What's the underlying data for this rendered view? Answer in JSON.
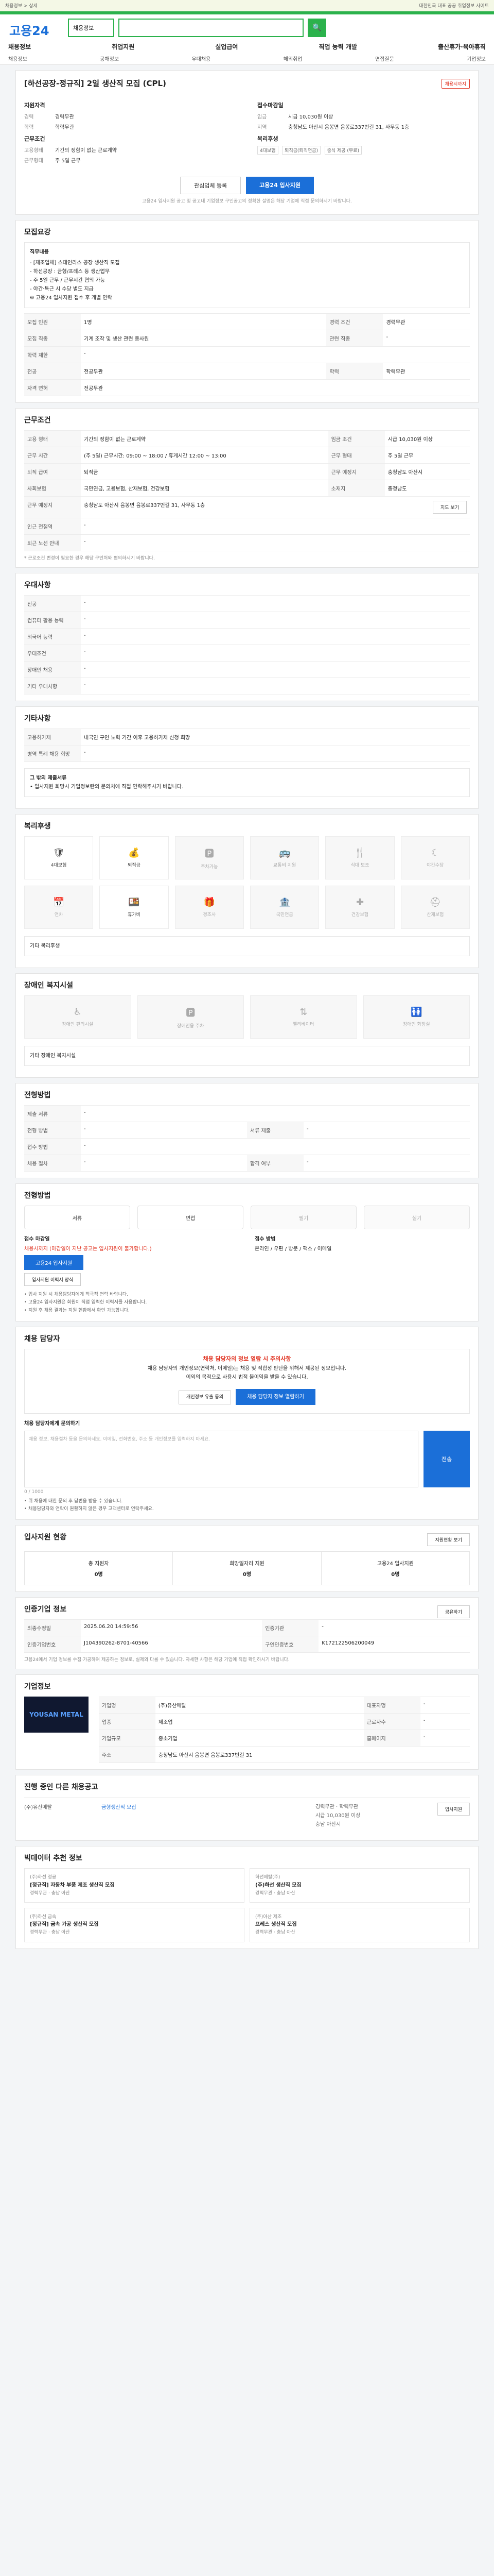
{
  "top": {
    "left": "채용정보 > 상세",
    "right": "대한민국 대표 공공 취업정보 사이트"
  },
  "header": {
    "logo": "고용24",
    "search_select": "채용정보",
    "search_button": "🔍",
    "gnb": [
      "채용정보",
      "취업지원",
      "실업급여",
      "직업 능력 개발",
      "출산휴가·육아휴직"
    ],
    "subnav": [
      "채용정보",
      "공채정보",
      "우대채용",
      "해외취업",
      "면접질문",
      "기업정보"
    ]
  },
  "job": {
    "title": "[하선공장-정규직] 2일 생산직 모집 (CPL)",
    "tag": "채용시까지",
    "apply_heading": "지원자격",
    "career_label": "경력",
    "career_value": "경력무관",
    "edu_label": "학력",
    "edu_value": "학력무관",
    "cond_heading": "근무조건",
    "type_label": "고용형태",
    "type_value": "기간의 정함이 없는 근로계약",
    "pay_label": "근무형태",
    "pay_value": "주 5일 근무",
    "deadline_heading": "접수마감일",
    "deadline_label": "임금",
    "deadline_value": "시급 10,030원 이상",
    "region_label": "지역",
    "region_value": "충청남도 아산시 음봉면 음봉로337번길 31, 사무동 1층",
    "welfare_heading": "복리후생",
    "welfare_badges": [
      "4대보험",
      "퇴직금(퇴직연금)",
      "중식 제공 (무료)"
    ],
    "btn_favorite": "관심업체 등록",
    "btn_apply": "고용24 입사지원",
    "notice": "고용24 입사지원 공고 및 공고내 기업정보 구인공고의 정확한 설명은 해당 기업에 직접 문의하시기 바랍니다."
  },
  "detail": {
    "heading": "모집요강",
    "box_title": "직무내용",
    "box_lines": [
      "- [제조업체] 스테인리스 공장 생산직 모집",
      "- 하선공장 : 금형/프레스 등 생산업무",
      "- 주 5일 근무 / 근무시간 협의 가능",
      "- 야간·특근 시 수당 별도 지급",
      "※ 고용24 입사지원 접수 후 개별 연락"
    ],
    "rows": [
      [
        "모집 인원",
        "1명",
        "경력 조건",
        "경력무관"
      ],
      [
        "모집 직종",
        "기계 조작 및 생산 관련 종사원",
        "관련 직종",
        "-"
      ],
      [
        "학력 제한",
        "-",
        "",
        ""
      ],
      [
        "전공",
        "전공무관",
        "학력",
        "학력무관"
      ],
      [
        "자격 면허",
        "전공무관",
        "",
        ""
      ]
    ]
  },
  "conditions": {
    "heading": "근무조건",
    "rows": [
      [
        "고용 형태",
        "기간의 정함이 없는 근로계약",
        "임금 조건",
        "시급 10,030원 이상"
      ],
      [
        "근무 시간",
        "(주 5일) 근무시간: 09:00 ~ 18:00 / 휴게시간 12:00 ~ 13:00",
        "근무 형태",
        "주 5일 근무"
      ],
      [
        "퇴직 급여",
        "퇴직금",
        "근무 예정지",
        "충청남도 아산시"
      ],
      [
        "사회보험",
        "국민연금, 고용보험, 산재보험, 건강보험",
        "소재지",
        "충청남도"
      ],
      [
        "근무 예정지",
        "충청남도 아산시 음봉면 음봉로337번길 31, 사무동 1층",
        "",
        ""
      ],
      [
        "인근 전철역",
        "-",
        "",
        ""
      ],
      [
        "퇴근 노선 안내",
        "-",
        "",
        ""
      ]
    ],
    "map_button": "지도 보기",
    "note": "* 근로조건 변경이 필요한 경우 해당 구인처와 협의하시기 바랍니다."
  },
  "prefer": {
    "heading": "우대사항",
    "rows": [
      [
        "전공",
        "-"
      ],
      [
        "컴퓨터 활용 능력",
        "-"
      ],
      [
        "외국어 능력",
        "-"
      ],
      [
        "우대조건",
        "-"
      ],
      [
        "장애인 채용",
        "-"
      ],
      [
        "기타 우대사항",
        "-"
      ]
    ]
  },
  "extra": {
    "heading": "기타사항",
    "rows": [
      [
        "고용허가제",
        "내국인 구인 노력 기간 이후 고용허가제 신청 희망"
      ],
      [
        "병역 특례 채용 희망",
        "-"
      ]
    ],
    "sub_heading": "그 밖의 제출서류",
    "sub_text": "• 입사지원 희망시 기업정보란의 문의처에 직접 연락해주시기 바랍니다."
  },
  "welfare": {
    "heading": "복리후생",
    "items": [
      "4대보험",
      "퇴직금",
      "주차가능",
      "교통비 지원",
      "식대 보조",
      "야간수당",
      "연차",
      "휴가비",
      "경조사",
      "국민연금",
      "건강보험",
      "산재보험"
    ],
    "other_label": "기타 복리후생"
  },
  "disabled": {
    "heading": "장애인 복지시설",
    "items": [
      "장애인 편의시설",
      "장애인용 주차",
      "엘리베이터",
      "장애인 화장실"
    ],
    "note": "기타 장애인 복지시설"
  },
  "method": {
    "heading": "전형방법",
    "rows": [
      [
        "제출 서류",
        "-",
        "",
        ""
      ],
      [
        "전형 방법",
        "-",
        "서류 제출",
        "-"
      ],
      [
        "접수 방법",
        "-",
        "",
        ""
      ],
      [
        "채용 절차",
        "-",
        "합격 여부",
        "-"
      ]
    ]
  },
  "process": {
    "heading": "전형방법",
    "steps": [
      "서류",
      "면접",
      "필기",
      "실기"
    ]
  },
  "applyinfo": {
    "deadline_label": "접수 마감일",
    "deadline_value": "채용시까지 (마감일이 지난 공고는 입사지원이 불가합니다.)",
    "btn_apply": "고용24 입사지원",
    "btn_form": "입사지원 이력서 양식",
    "method_label": "접수 방법",
    "method_value": "온라인 / 우편 / 방문 / 팩스 / 이메일",
    "notes": [
      "• 입사 지원 시 채용담당자에게 적극적 연락 바랍니다.",
      "• 고용24 입사지원은 회원이 직접 입력한 이력서를 사용합니다.",
      "• 지원 후 채용 결과는 지원 현황에서 확인 가능합니다."
    ]
  },
  "contact": {
    "heading": "채용 담당자",
    "alert_title": "채용 담당자의 정보 열람 시 주의사항",
    "alert_lines": [
      "채용 담당자의 개인정보(연락처, 이메일)는 채용 및 적합성 판단을 위해서 제공된 정보입니다.",
      "이외의 목적으로 사용시 법적 불이익을 받을 수 있습니다."
    ],
    "btn_info": "개인정보 유출 동의",
    "btn_view": "채용 담당자 정보 열람하기",
    "inquiry_label": "채용 담당자에게 문의하기",
    "inquiry_placeholder": "채용 정보, 채용절차 등을 문의하세요. 이메일, 전화번호, 주소 등 개인정보를 입력하지 마세요.",
    "inquiry_count": "0 / 1000",
    "inquiry_submit": "전송",
    "notes": [
      "• 위 채용에 대한 문의 후 답변을 받을 수 있습니다.",
      "• 채용담당자와 연락이 원활하지 않은 경우 고객센터로 연락주세요."
    ]
  },
  "status": {
    "heading": "입사지원 현황",
    "view_btn": "지원현황 보기",
    "items": [
      [
        "총 지원자",
        "0명"
      ],
      [
        "희망일자리 지원",
        "0명"
      ],
      [
        "고용24 입사지원",
        "0명"
      ]
    ]
  },
  "info": {
    "heading": "인증기업 정보",
    "share": "공유하기",
    "rows": [
      [
        "최종수정일",
        "2025.06.20 14:59:56",
        "인증기관",
        "-"
      ],
      [
        "인증기업번호",
        "J104390262-8701-40566",
        "구인인증번호",
        "K172122506200049"
      ]
    ],
    "note": "고용24에서 기업 정보를 수집·가공하여 제공하는 정보로, 실제와 다를 수 있습니다. 자세한 사항은 해당 기업에 직접 확인하시기 바랍니다."
  },
  "company": {
    "heading": "기업정보",
    "logo_text": "YOUSAN METAL",
    "rows": [
      [
        "기업명",
        "(주)유산메탈",
        "대표자명",
        "-"
      ],
      [
        "업종",
        "제조업",
        "근로자수",
        "-"
      ],
      [
        "기업규모",
        "중소기업",
        "홈페이지",
        "-"
      ],
      [
        "주소",
        "충청남도 아산시 음봉면 음봉로337번길 31",
        "",
        ""
      ]
    ]
  },
  "others": {
    "heading": "진행 중인 다른 채용공고",
    "jobs": [
      {
        "company": "(주)유산메탈",
        "title": "금형생산직 모집",
        "meta": [
          "경력무관 · 학력무관",
          "시급 10,030원 이상",
          "충남 아산시"
        ],
        "btn": "입사지원"
      }
    ]
  },
  "reco": {
    "heading": "빅데이터 추천 정보",
    "items": [
      {
        "company": "(주)하선 정공",
        "title": "[정규직] 자동차 부품 제조 생산직 모집",
        "meta": "경력무관 · 충남 아산"
      },
      {
        "company": "하선메탈(주)",
        "title": "(주)하선 생산직 모집",
        "meta": "경력무관 · 충남 아산"
      },
      {
        "company": "(주)하선 금속",
        "title": "[정규직] 금속 가공 생산직 모집",
        "meta": "경력무관 · 충남 아산"
      },
      {
        "company": "(주)아산 제조",
        "title": "프레스 생산직 모집",
        "meta": "경력무관 · 충남 아산"
      }
    ]
  }
}
